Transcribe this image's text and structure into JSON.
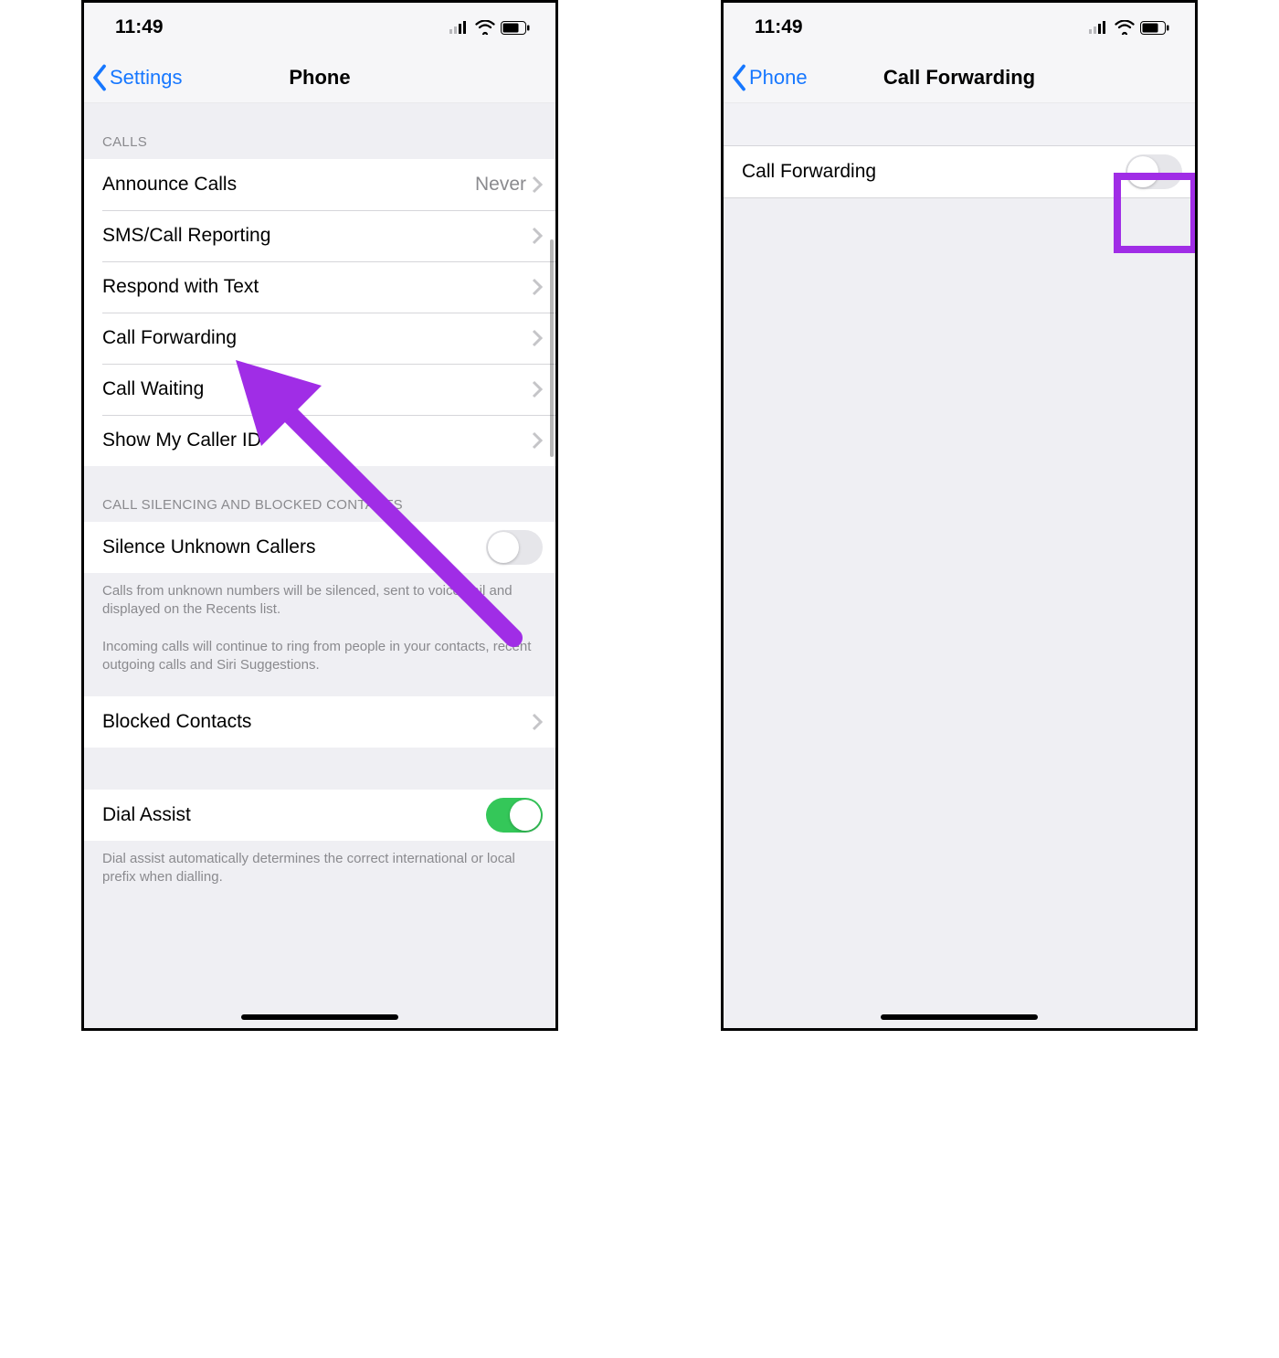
{
  "status": {
    "time": "11:49"
  },
  "left": {
    "back_label": "Settings",
    "title": "Phone",
    "sections": {
      "calls_header": "CALLS",
      "rows": {
        "announce": {
          "label": "Announce Calls",
          "value": "Never"
        },
        "sms": {
          "label": "SMS/Call Reporting"
        },
        "respond": {
          "label": "Respond with Text"
        },
        "fwd": {
          "label": "Call Forwarding"
        },
        "wait": {
          "label": "Call Waiting"
        },
        "caller": {
          "label": "Show My Caller ID"
        }
      },
      "silence_header": "CALL SILENCING AND BLOCKED CONTACTS",
      "silence_row": {
        "label": "Silence Unknown Callers",
        "on": false
      },
      "silence_note1": "Calls from unknown numbers will be silenced, sent to voicemail and displayed on the Recents list.",
      "silence_note2": "Incoming calls will continue to ring from people in your contacts, recent outgoing calls and Siri Suggestions.",
      "blocked": {
        "label": "Blocked Contacts"
      },
      "dial": {
        "label": "Dial Assist",
        "on": true
      },
      "dial_note": "Dial assist automatically determines the correct international or local prefix when dialling."
    }
  },
  "right": {
    "back_label": "Phone",
    "title": "Call Forwarding",
    "row": {
      "label": "Call Forwarding",
      "on": false
    }
  },
  "colors": {
    "annotation": "#a02de6",
    "link": "#1677ff",
    "toggle_on": "#34c759"
  }
}
